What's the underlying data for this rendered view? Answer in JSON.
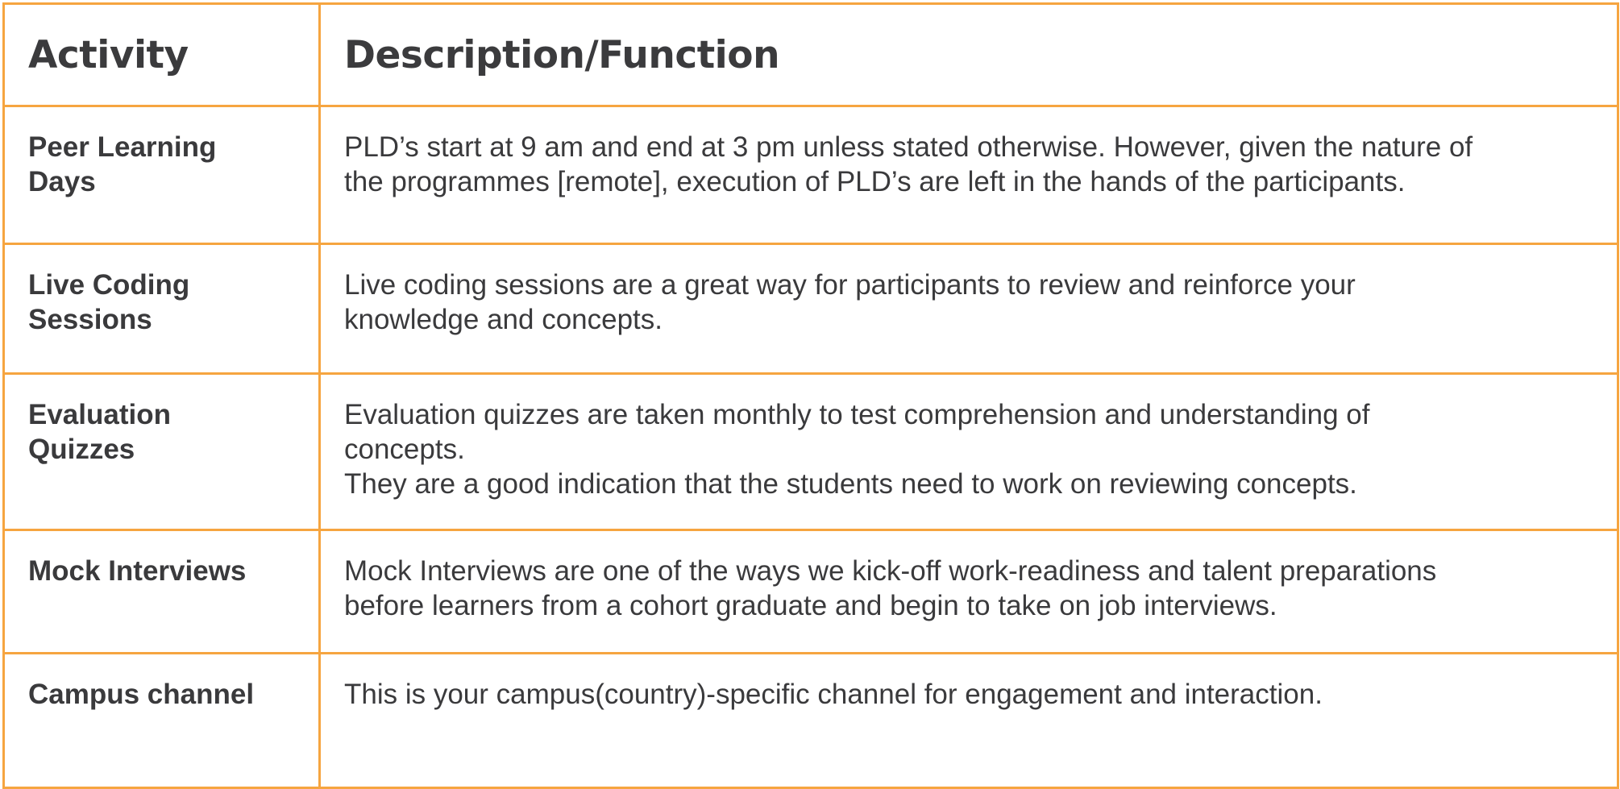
{
  "table": {
    "headers": {
      "activity": "Activity",
      "description": "Description/Function"
    },
    "rows": [
      {
        "activity": [
          "Peer Learning",
          "Days"
        ],
        "description": [
          "PLD’s start at 9 am and end at 3 pm unless stated otherwise. However, given the nature of",
          "the programmes [remote], execution of PLD’s are left in the hands of the participants."
        ]
      },
      {
        "activity": [
          "Live Coding",
          "Sessions"
        ],
        "description": [
          "Live coding sessions are a great way for participants to review and reinforce your",
          "knowledge and concepts."
        ]
      },
      {
        "activity": [
          "Evaluation",
          "Quizzes"
        ],
        "description": [
          "Evaluation quizzes are taken monthly to test comprehension and understanding of",
          "concepts.",
          "They are a good indication that the students need to work on reviewing concepts."
        ]
      },
      {
        "activity": [
          "Mock Interviews"
        ],
        "description": [
          "Mock Interviews are one of the ways we kick-off work-readiness and talent preparations",
          "before learners from a cohort graduate and begin to take on job interviews."
        ]
      },
      {
        "activity": [
          "Campus channel"
        ],
        "description": [
          "This is your campus(country)-specific channel for engagement and interaction."
        ]
      }
    ]
  },
  "colors": {
    "border": "#f6a540",
    "text": "#3a3a3c",
    "background": "#ffffff"
  }
}
